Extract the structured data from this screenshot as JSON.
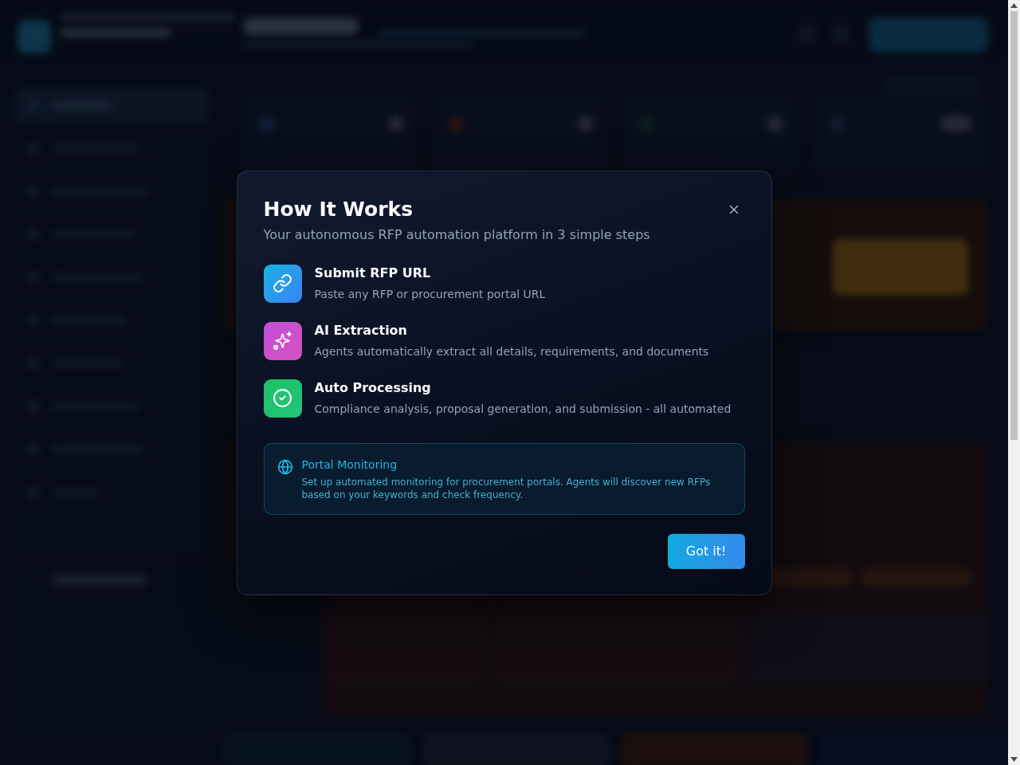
{
  "dialog": {
    "title": "How It Works",
    "subtitle": "Your autonomous RFP automation platform in 3 simple steps",
    "steps": [
      {
        "kind": "link",
        "title": "Submit RFP URL",
        "description": "Paste any RFP or procurement portal URL"
      },
      {
        "kind": "sparkles",
        "title": "AI Extraction",
        "description": "Agents automatically extract all details, requirements, and documents"
      },
      {
        "kind": "check",
        "title": "Auto Processing",
        "description": "Compliance analysis, proposal generation, and submission - all automated"
      }
    ],
    "info": {
      "title": "Portal Monitoring",
      "text": "Set up automated monitoring for procurement portals. Agents will discover new RFPs based on your keywords and check frequency."
    },
    "button": "Got it!"
  }
}
